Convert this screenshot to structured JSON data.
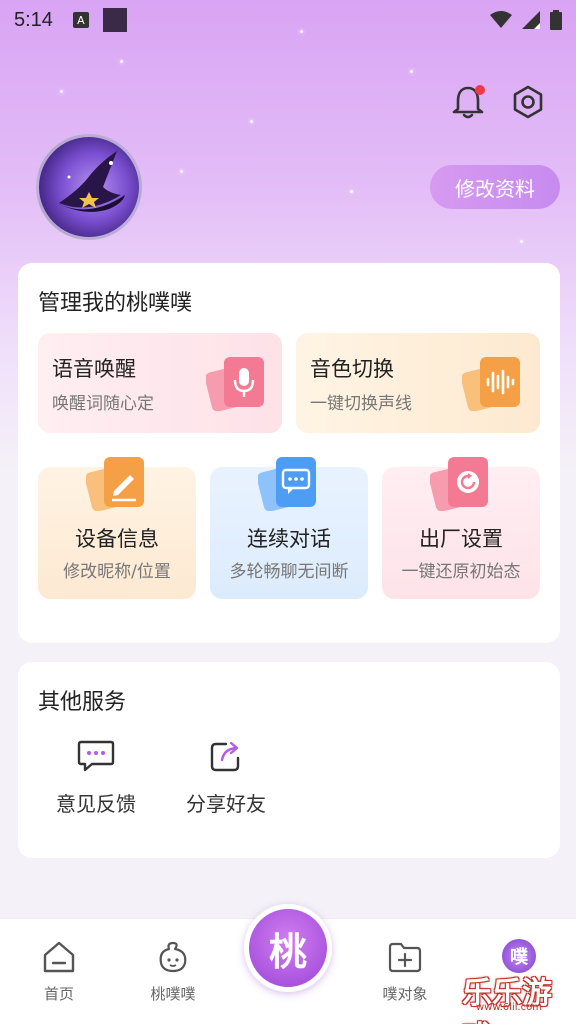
{
  "status_bar": {
    "time": "5:14",
    "badge": "A"
  },
  "header": {
    "edit_profile": "修改资料"
  },
  "manage": {
    "title": "管理我的桃噗噗",
    "tiles": [
      {
        "title": "语音唤醒",
        "subtitle": "唤醒词随心定",
        "icon": "microphone-icon",
        "color": "#f37a92"
      },
      {
        "title": "音色切换",
        "subtitle": "一键切换声线",
        "icon": "sound-wave-icon",
        "color": "#f5a046"
      },
      {
        "title": "设备信息",
        "subtitle": "修改昵称/位置",
        "icon": "pencil-icon",
        "color": "#f5a046"
      },
      {
        "title": "连续对话",
        "subtitle": "多轮畅聊无间断",
        "icon": "chat-bubble-icon",
        "color": "#4e9df5"
      },
      {
        "title": "出厂设置",
        "subtitle": "一键还原初始态",
        "icon": "reset-icon",
        "color": "#f37a92"
      }
    ]
  },
  "services": {
    "title": "其他服务",
    "items": [
      {
        "label": "意见反馈",
        "icon": "feedback-icon"
      },
      {
        "label": "分享好友",
        "icon": "share-icon"
      }
    ]
  },
  "tabbar": {
    "items": [
      {
        "label": "首页",
        "icon": "home-icon"
      },
      {
        "label": "桃噗噗",
        "icon": "character-icon"
      },
      {
        "label": "噗对象",
        "icon": "add-folder-icon"
      }
    ],
    "center": "桃",
    "profile_badge": "噗"
  },
  "watermark": {
    "text": "乐乐游戏",
    "url": "www.6lil.com"
  },
  "colors": {
    "accent": "#c78bf0",
    "hero_top": "#d9a4f4",
    "notification_dot": "#f0384a"
  }
}
